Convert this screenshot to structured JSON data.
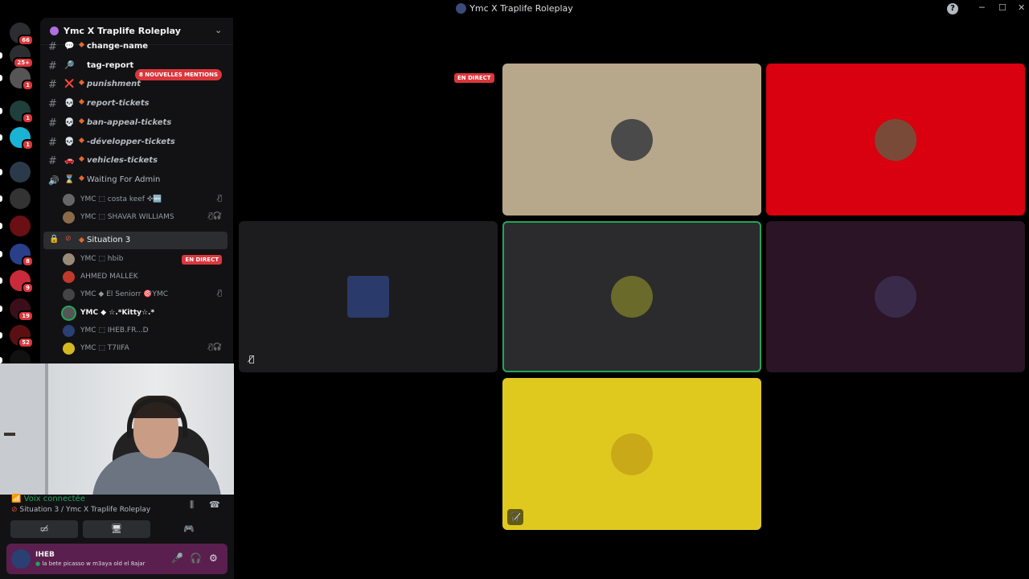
{
  "window": {
    "title": "Ymc X Traplife Roleplay"
  },
  "servers": [
    {
      "name": "discord-home",
      "badge": "66",
      "color": "#2b2d31"
    },
    {
      "name": "notifications",
      "badge": "25+",
      "color": "#2b2d31"
    },
    {
      "name": "server-1",
      "badge": "1",
      "color": "#555"
    },
    {
      "name": "server-add",
      "badge": "1",
      "color": "#1f3f3a"
    },
    {
      "name": "server-cyan",
      "badge": "1",
      "color": "#1bb3d4"
    },
    {
      "name": "server-serena",
      "badge": "",
      "color": "#2a3a4a"
    },
    {
      "name": "server-dark",
      "badge": "",
      "color": "#333"
    },
    {
      "name": "server-ymc",
      "badge": "",
      "color": "#6a0f13"
    },
    {
      "name": "server-blue",
      "badge": "8",
      "color": "#2a3f8a"
    },
    {
      "name": "server-red",
      "badge": "9",
      "color": "#c92b3a"
    },
    {
      "name": "server-pvp",
      "badge": "19",
      "color": "#3a0f1a"
    },
    {
      "name": "server-ryk",
      "badge": "52",
      "color": "#5a1010"
    },
    {
      "name": "server-kick",
      "badge": "",
      "color": "#111"
    }
  ],
  "sidebar": {
    "guild_name": "Ymc X Traplife Roleplay",
    "mentions_badge": "8 nouvelles mentions",
    "channels": [
      {
        "emoji": "💬",
        "label": "change-name"
      },
      {
        "emoji": "🔎",
        "label": "tag-report"
      },
      {
        "emoji": "❌",
        "label": "punishment"
      },
      {
        "emoji": "💀",
        "label": "report-tickets"
      },
      {
        "emoji": "💀",
        "label": "ban-appeal-tickets"
      },
      {
        "emoji": "💀",
        "label": "-développer-tickets"
      },
      {
        "emoji": "🚗",
        "label": "vehicles-tickets"
      },
      {
        "emoji": "⌛",
        "label": "Waiting For Admin"
      }
    ],
    "waiting_users": [
      {
        "name": "YMC ⬚ costa keef ✜🆕",
        "color": "#666"
      },
      {
        "name": "YMC ⬚ SHAVAR WILLIAMS",
        "color": "#8a6a4a"
      }
    ],
    "voice_channel": "Situation 3",
    "voice_users": [
      {
        "name": "YMC ⬚ hbib",
        "color": "#9a8a7a",
        "live": "EN DIRECT"
      },
      {
        "name": "AHMED MALLEK",
        "color": "#c0392b"
      },
      {
        "name": "YMC ◆ El Seniorr 🎯YMC",
        "color": "#444"
      },
      {
        "name": "YMC ◆ ☆.*Kitty☆.*",
        "color": "#555"
      },
      {
        "name": "YMC ⬚ IHEB.FR...D",
        "color": "#2a3f72"
      },
      {
        "name": "YMC ⬚ T7IIFA",
        "color": "#d4b820"
      }
    ]
  },
  "voice_panel": {
    "status": "Voix connectée",
    "channel": "Situation 3 / Ymc X Traplife Roleplay"
  },
  "user": {
    "name": "IHEB",
    "status": "la bete picasso w m3aya old el 8ajar"
  },
  "stage": {
    "live_label": "EN DIRECT"
  },
  "tiles": [
    {
      "name": "tile-beige",
      "bg": "#b7a88b",
      "avatar": "#4a4a4a"
    },
    {
      "name": "tile-red",
      "bg": "#d9000f",
      "avatar": "#7a4a38"
    },
    {
      "name": "tile-cartoon",
      "bg": "#1c1c1e",
      "avatar": "#2a3a6a"
    },
    {
      "name": "tile-active",
      "bg": "#2b2b2d",
      "avatar": "#6a6a2a"
    },
    {
      "name": "tile-purple",
      "bg": "#2a1425",
      "avatar": "#3a2a4a"
    },
    {
      "name": "tile-yellow",
      "bg": "#dfc91f",
      "avatar": "#caa918"
    }
  ],
  "colors": {
    "accent": "#5865f2",
    "live": "#da373c",
    "voice_green": "#23a55a",
    "speaking": "#23a55a"
  }
}
